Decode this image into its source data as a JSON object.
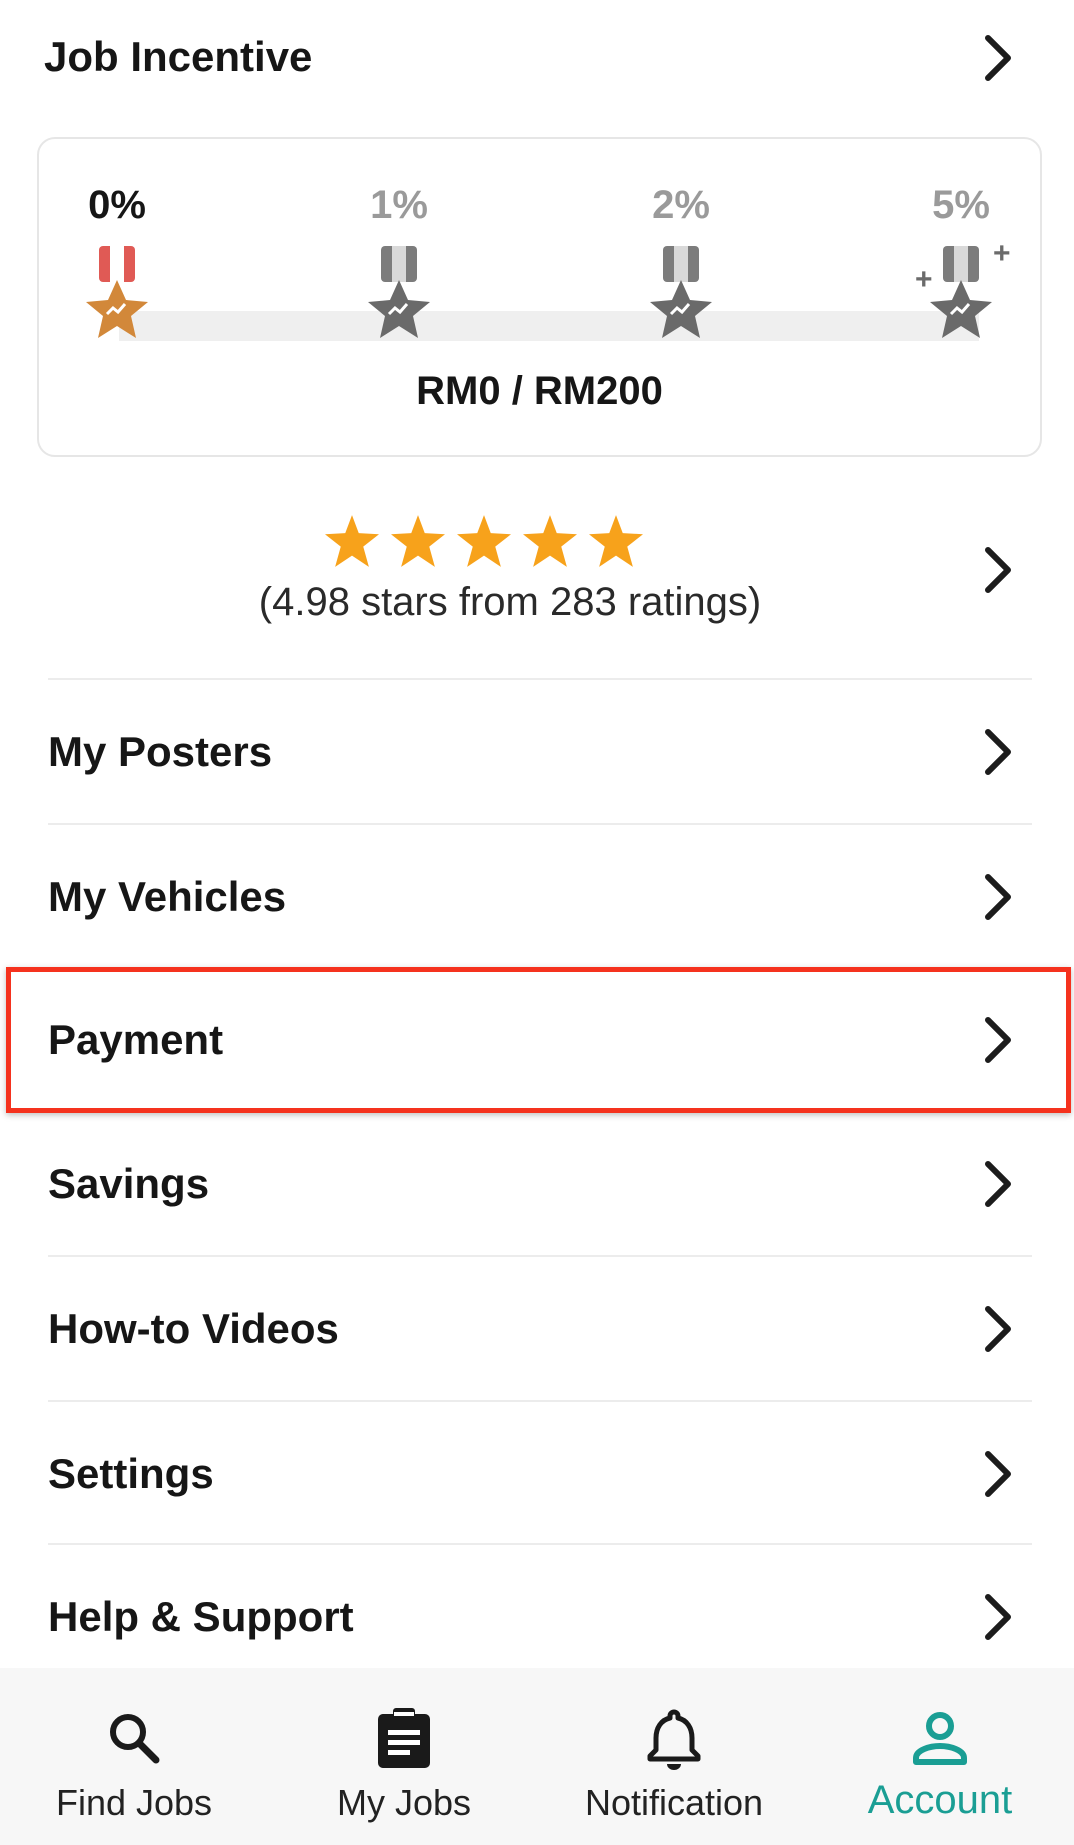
{
  "colors": {
    "accent": "#1a9e94",
    "star": "#f7a21b",
    "highlight": "#f5321e",
    "bronze": "#d2883a"
  },
  "header": {
    "title": "Job Incentive",
    "chevron_icon": "chevron-right-icon"
  },
  "incentive": {
    "tiers": [
      {
        "label": "0%",
        "active": true
      },
      {
        "label": "1%",
        "active": false
      },
      {
        "label": "2%",
        "active": false
      },
      {
        "label": "5%",
        "active": false
      }
    ],
    "plus_sign": "+",
    "progress_text": "RM0 / RM200"
  },
  "rating": {
    "star_count": 5,
    "text": "(4.98 stars from 283 ratings)"
  },
  "menu": [
    {
      "label": "My Posters"
    },
    {
      "label": "My Vehicles"
    },
    {
      "label": "Payment"
    },
    {
      "label": "Savings"
    },
    {
      "label": "How-to Videos"
    },
    {
      "label": "Settings"
    },
    {
      "label": "Help & Support"
    }
  ],
  "bottom_nav": [
    {
      "label": "Find Jobs",
      "icon": "search-icon"
    },
    {
      "label": "My Jobs",
      "icon": "clipboard-icon"
    },
    {
      "label": "Notification",
      "icon": "bell-icon"
    },
    {
      "label": "Account",
      "icon": "person-icon",
      "active": true
    }
  ]
}
